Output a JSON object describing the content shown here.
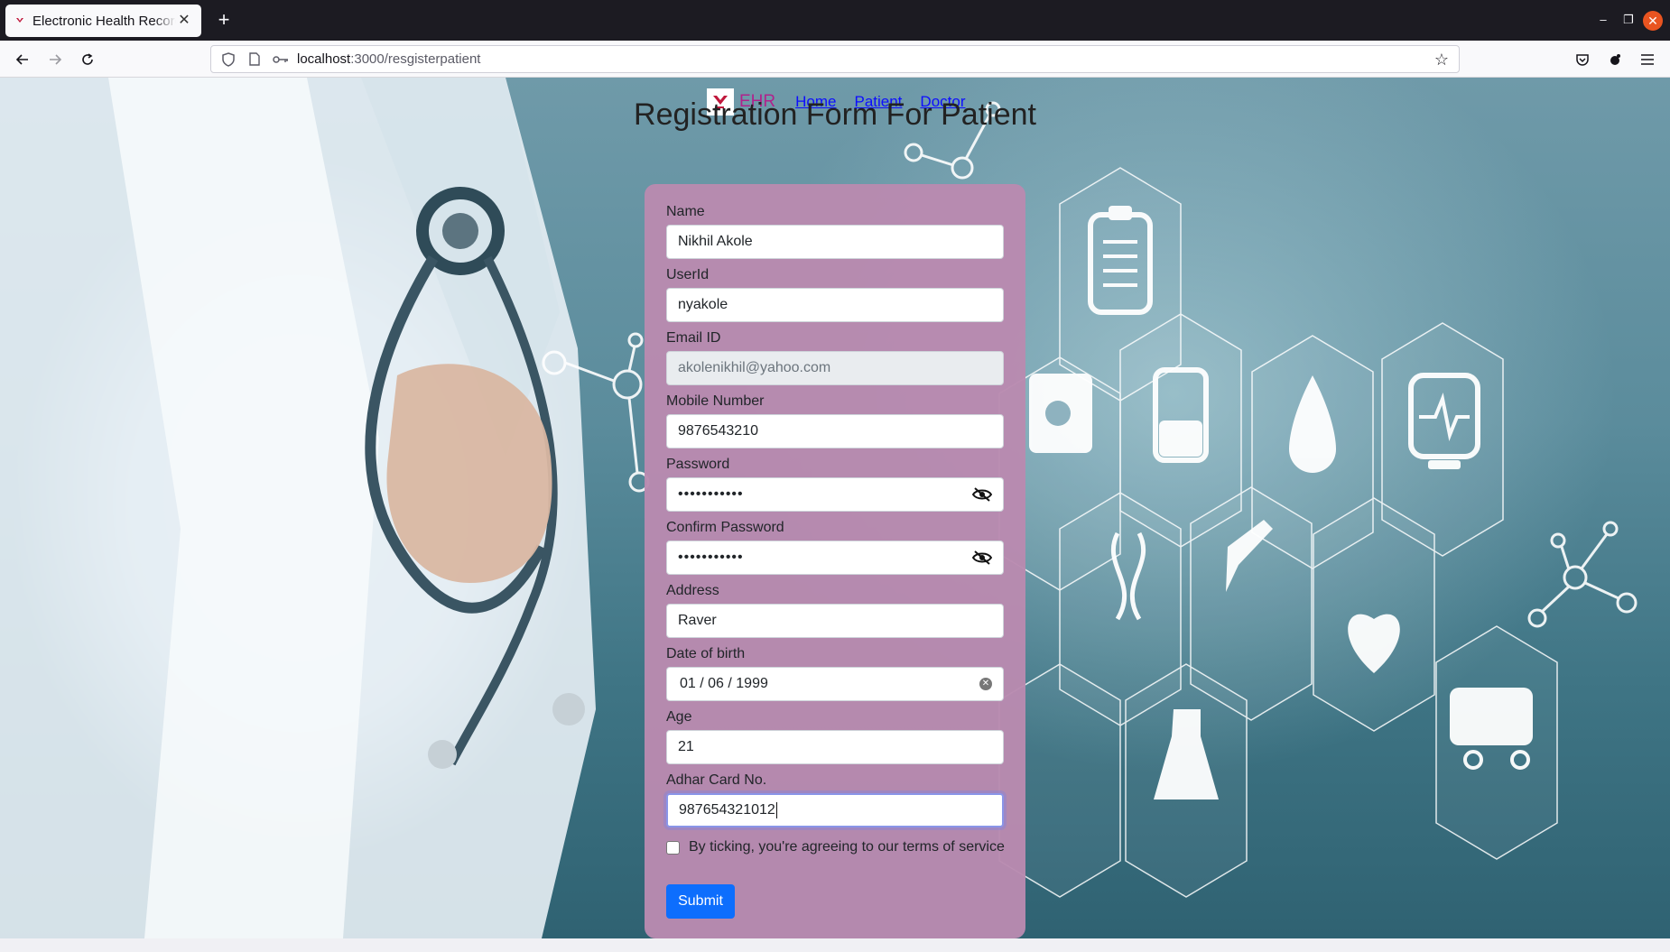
{
  "browser": {
    "tab_title": "Electronic Health Records",
    "new_tab_icon": "plus-icon",
    "url_host": "localhost",
    "url_path": ":3000/resgisterpatient"
  },
  "page": {
    "brand": "EHR",
    "nav_links": [
      "Home",
      "Patient",
      "Doctor"
    ],
    "title": "Registration Form For Patient"
  },
  "form": {
    "name_label": "Name",
    "name_value": "Nikhil Akole",
    "userid_label": "UserId",
    "userid_value": "nyakole",
    "email_label": "Email ID",
    "email_value": "akolenikhil@yahoo.com",
    "mobile_label": "Mobile Number",
    "mobile_value": "9876543210",
    "password_label": "Password",
    "password_value": "•••••••••••",
    "confirm_label": "Confirm Password",
    "confirm_value": "•••••••••••",
    "address_label": "Address",
    "address_value": "Raver",
    "dob_label": "Date of birth",
    "dob_value": "01 / 06 / 1999",
    "age_label": "Age",
    "age_value": "21",
    "adhar_label": "Adhar Card No.",
    "adhar_value": "987654321012",
    "terms_text": "By ticking, you're agreeing to our terms of service",
    "terms_checked": false,
    "submit_label": "Submit"
  },
  "colors": {
    "card": "#b98ab0",
    "brand": "#b0228c",
    "nav_link": "#0d0dff",
    "submit": "#0d6efd"
  }
}
